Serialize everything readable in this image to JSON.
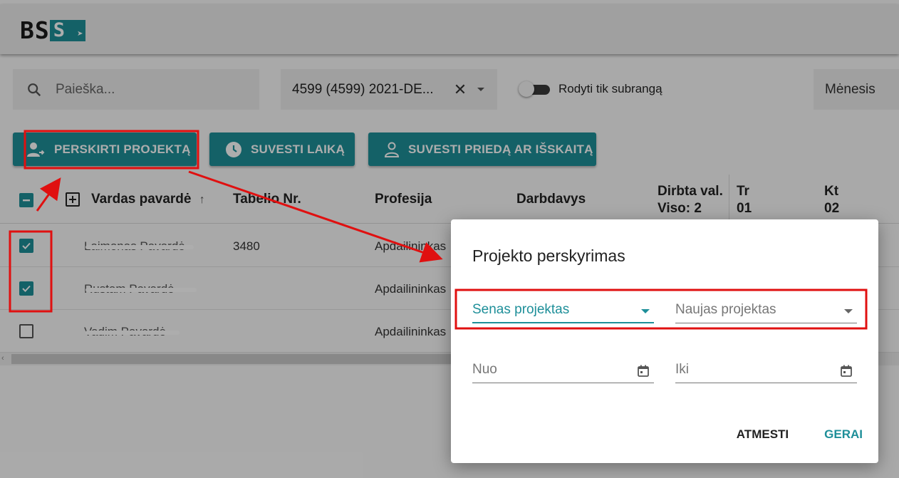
{
  "app": {
    "logo_left": "BS",
    "logo_right": "S"
  },
  "search": {
    "placeholder": "Paieška..."
  },
  "project_filter": {
    "value": "4599 (4599) 2021-DE..."
  },
  "subcontract_toggle": {
    "label": "Rodyti tik subrangą",
    "checked": false
  },
  "period": {
    "value": "Mėnesis"
  },
  "actions": {
    "assign_project": "PERSKIRTI PROJEKTĄ",
    "enter_time": "SUVESTI LAIKĄ",
    "enter_bonus": "SUVESTI PRIEDĄ AR IŠSKAITĄ"
  },
  "table": {
    "headers": {
      "name": "Vardas pavardė",
      "sort_indicator": "↑",
      "tabel_no": "Tabelio Nr.",
      "profession": "Profesija",
      "employer": "Darbdavys",
      "worked_line1": "Dirbta val.",
      "worked_line2": "Viso: 2",
      "day1_line1": "Tr",
      "day1_line2": "01",
      "day2_line1": "Kt",
      "day2_line2": "02"
    },
    "rows": [
      {
        "name": "Laimonas Pavardė",
        "tabel_no": "3480",
        "profession": "Apdailininkas",
        "selected": true
      },
      {
        "name": "Rustam Pavardė",
        "tabel_no": "",
        "profession": "Apdailininkas",
        "selected": true
      },
      {
        "name": "Vadim Pavardė",
        "tabel_no": "",
        "profession": "Apdailininkas",
        "selected": false
      }
    ]
  },
  "dialog": {
    "title": "Projekto perskyrimas",
    "old_project_label": "Senas projektas",
    "new_project_label": "Naujas projektas",
    "from_label": "Nuo",
    "to_label": "Iki",
    "cancel": "ATMESTI",
    "ok": "GERAI"
  },
  "colors": {
    "accent": "#1e8f99",
    "annotation": "#e01010"
  }
}
